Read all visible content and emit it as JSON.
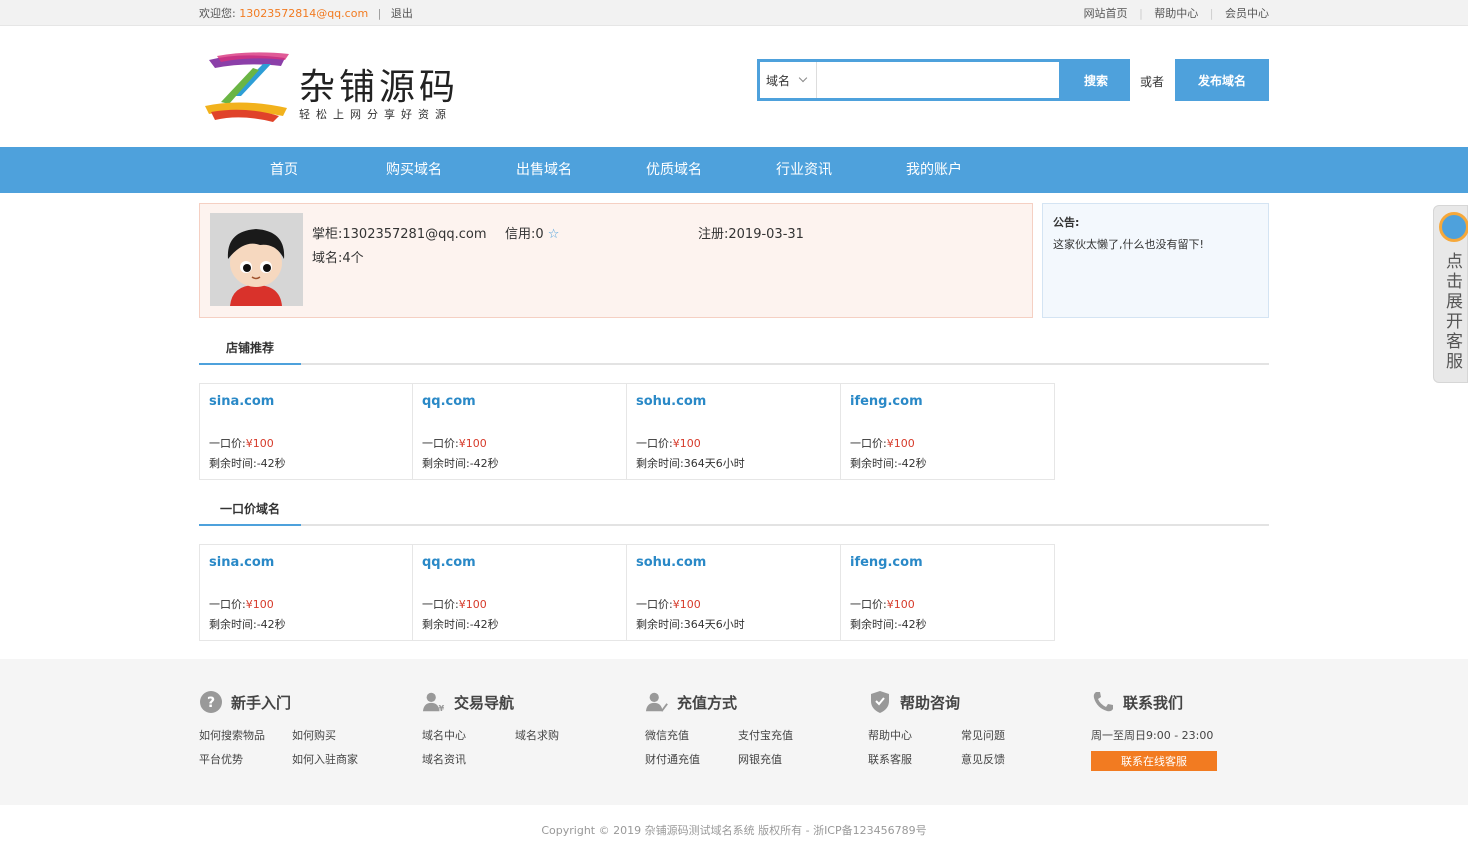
{
  "topbar": {
    "welcome_label": "欢迎您:",
    "email": "13023572814@qq.com",
    "separator": "|",
    "logout": "退出",
    "links": [
      "网站首页",
      "帮助中心",
      "会员中心"
    ]
  },
  "header": {
    "logo_title": "杂铺源码",
    "logo_subtitle": "轻松上网分享好资源",
    "search_select": "域名",
    "search_placeholder": "",
    "search_button": "搜索",
    "or_text": "或者",
    "publish_button": "发布域名"
  },
  "nav": {
    "items": [
      "首页",
      "购买域名",
      "出售域名",
      "优质域名",
      "行业资讯",
      "我的账户"
    ]
  },
  "shop": {
    "owner": "掌柜:1302357281@qq.com",
    "credit": "信用:0",
    "registered": "注册:2019-03-31",
    "domain_count": "域名:4个"
  },
  "notice": {
    "title": "公告:",
    "text": "这家伙太懒了,什么也没有留下!"
  },
  "sections": [
    {
      "title": "店铺推荐",
      "cards": [
        {
          "domain": "sina.com",
          "price_label": "一口价:",
          "price": "¥100",
          "time": "剩余时间:-42秒"
        },
        {
          "domain": "qq.com",
          "price_label": "一口价:",
          "price": "¥100",
          "time": "剩余时间:-42秒"
        },
        {
          "domain": "sohu.com",
          "price_label": "一口价:",
          "price": "¥100",
          "time": "剩余时间:364天6小时"
        },
        {
          "domain": "ifeng.com",
          "price_label": "一口价:",
          "price": "¥100",
          "time": "剩余时间:-42秒"
        }
      ]
    },
    {
      "title": "一口价域名",
      "cards": [
        {
          "domain": "sina.com",
          "price_label": "一口价:",
          "price": "¥100",
          "time": "剩余时间:-42秒"
        },
        {
          "domain": "qq.com",
          "price_label": "一口价:",
          "price": "¥100",
          "time": "剩余时间:-42秒"
        },
        {
          "domain": "sohu.com",
          "price_label": "一口价:",
          "price": "¥100",
          "time": "剩余时间:364天6小时"
        },
        {
          "domain": "ifeng.com",
          "price_label": "一口价:",
          "price": "¥100",
          "time": "剩余时间:-42秒"
        }
      ]
    }
  ],
  "footer": {
    "columns": [
      {
        "title": "新手入门",
        "icon": "question-icon",
        "links": [
          "如何搜索物品",
          "如何购买",
          "平台优势",
          "如何入驻商家"
        ]
      },
      {
        "title": "交易导航",
        "icon": "user-yen-icon",
        "links": [
          "域名中心",
          "域名求购",
          "域名资讯"
        ]
      },
      {
        "title": "充值方式",
        "icon": "user-pen-icon",
        "links": [
          "微信充值",
          "支付宝充值",
          "财付通充值",
          "网银充值"
        ]
      },
      {
        "title": "帮助咨询",
        "icon": "shield-icon",
        "links": [
          "帮助中心",
          "常见问题",
          "联系客服",
          "意见反馈"
        ]
      },
      {
        "title": "联系我们",
        "icon": "phone-icon",
        "hours": "周一至周日9:00 - 23:00",
        "button": "联系在线客服"
      }
    ],
    "copyright": "Copyright © 2019 杂铺源码测试域名系统 版权所有 - 浙ICP备123456789号"
  },
  "side_service": {
    "text": "点击展开客服"
  },
  "colors": {
    "primary": "#4ea1dc",
    "accent": "#f27b21",
    "price": "#d63b2b"
  }
}
